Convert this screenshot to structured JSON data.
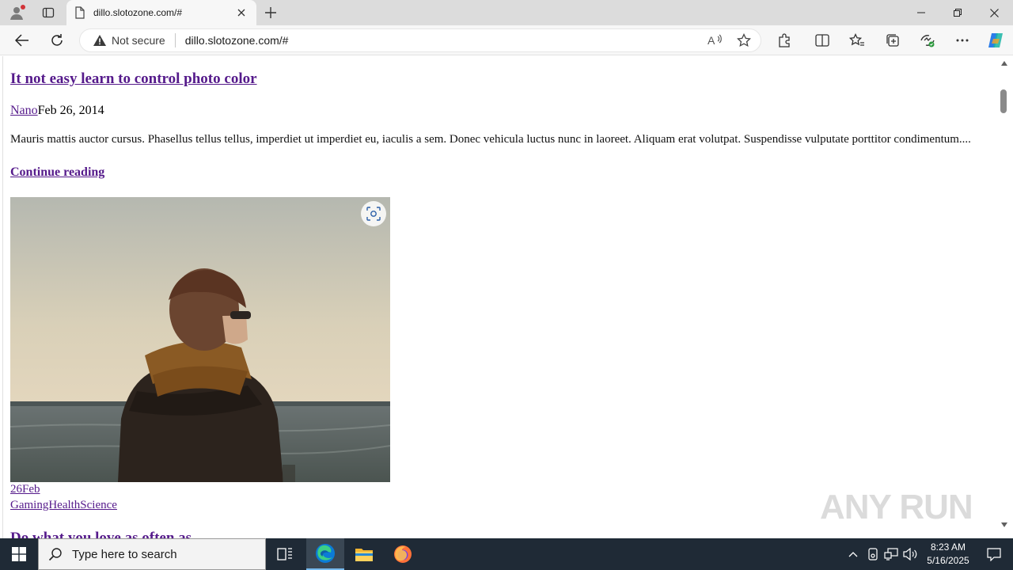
{
  "browser": {
    "tab_title": "dillo.slotozone.com/#",
    "address_security": "Not secure",
    "address_url": "dillo.slotozone.com/#"
  },
  "post": {
    "title": "It not easy learn to control photo color",
    "author": "Nano",
    "date": "Feb 26, 2014",
    "excerpt": "Mauris mattis auctor cursus. Phasellus tellus tellus, imperdiet ut imperdiet eu, iaculis a sem. Donec vehicula luctus nunc in laoreet. Aliquam erat volutpat. Suspendisse vulputate porttitor condimentum....",
    "continue_label": "Continue reading",
    "date_link": "26Feb",
    "categories": "GamingHealthScience",
    "next_title": "Do what you love as often as ..."
  },
  "watermark": {
    "text": "ANY RUN"
  },
  "taskbar": {
    "search_placeholder": "Type here to search",
    "time": "8:23 AM",
    "date": "5/16/2025"
  },
  "colors": {
    "link_visited": "#551a8b",
    "taskbar_bg": "#1f2a36",
    "edge_accent": "#0078d4"
  },
  "icons": [
    "profile-icon",
    "tab-actions-icon",
    "page-icon",
    "close-icon",
    "plus-icon",
    "minimize-icon",
    "restore-icon",
    "back-icon",
    "refresh-icon",
    "warning-icon",
    "read-aloud-icon",
    "favorite-star-icon",
    "extensions-icon",
    "split-screen-icon",
    "favorites-icon",
    "collections-icon",
    "performance-icon",
    "more-icon",
    "copilot-icon",
    "visual-search-icon",
    "windows-start-icon",
    "search-icon",
    "task-view-icon",
    "edge-icon",
    "file-explorer-icon",
    "firefox-icon",
    "chevron-up-icon",
    "network-icon",
    "volume-icon",
    "notification-icon"
  ]
}
